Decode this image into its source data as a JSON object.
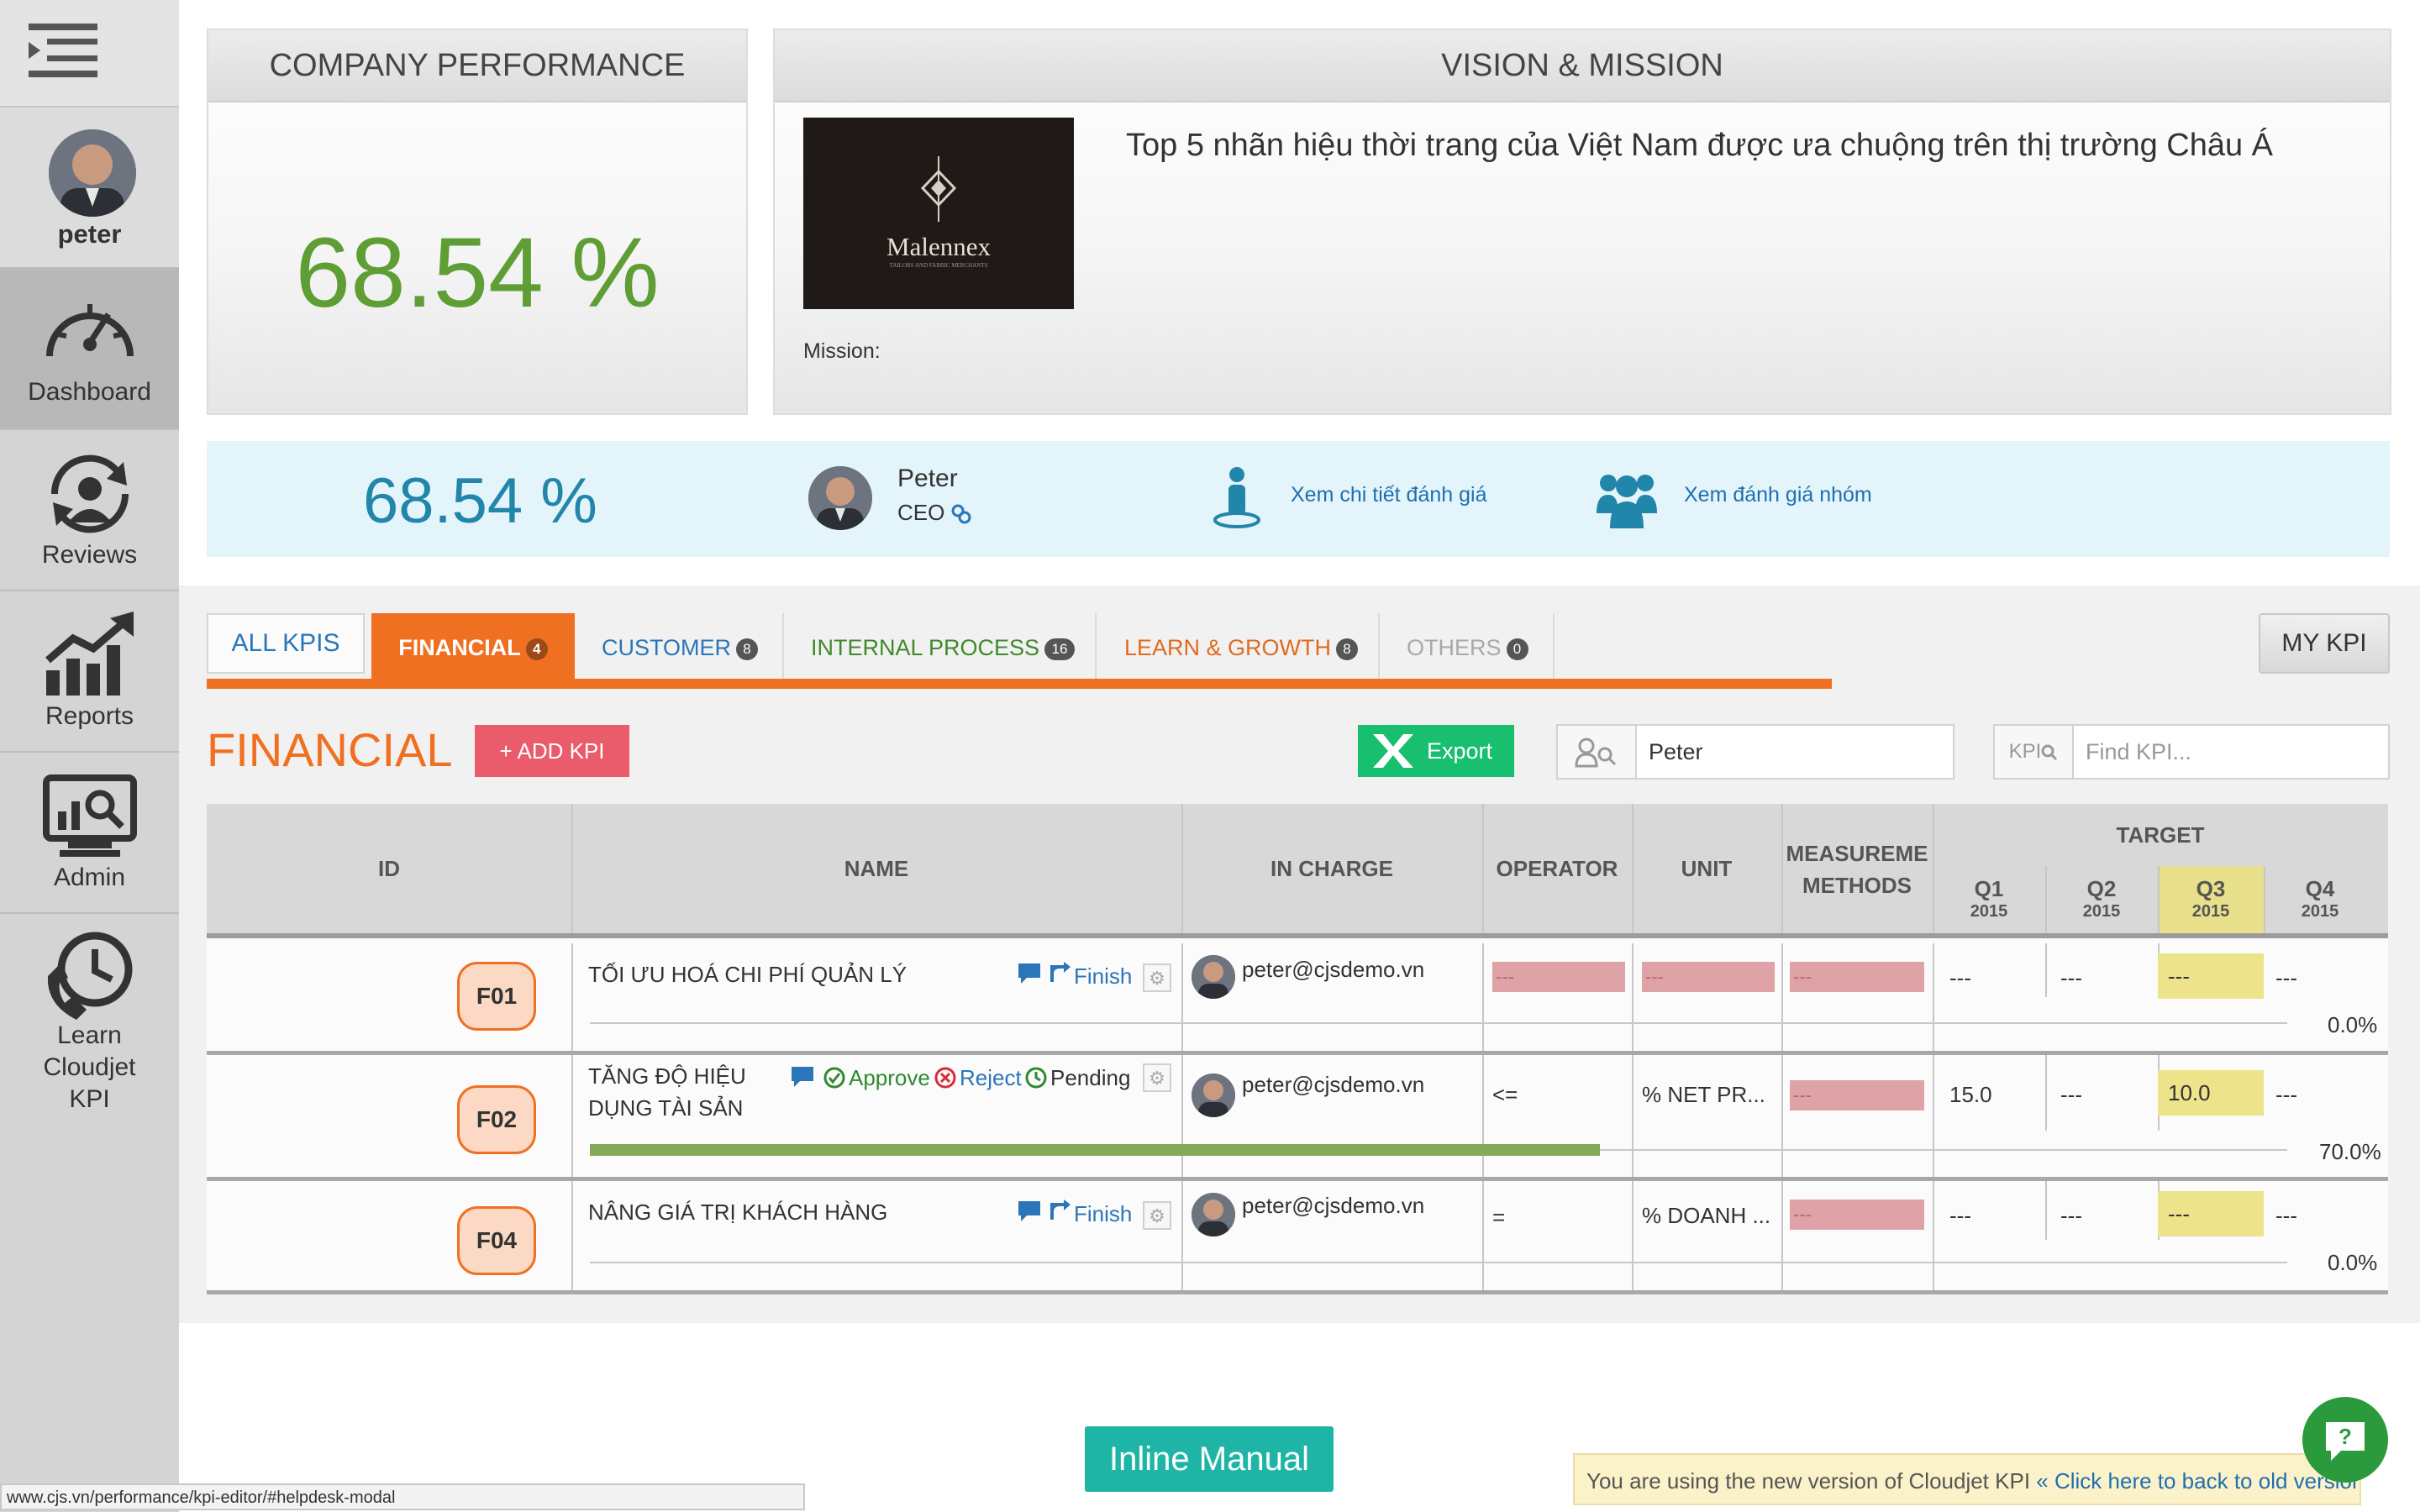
{
  "sidebar": {
    "user": "peter",
    "items": [
      {
        "label": "Dashboard",
        "icon": "speedometer-icon"
      },
      {
        "label": "Reviews",
        "icon": "reviews-icon"
      },
      {
        "label": "Reports",
        "icon": "chart-icon"
      },
      {
        "label": "Admin",
        "icon": "admin-icon"
      },
      {
        "label": "Learn\nCloudjet\nKPI",
        "icon": "clock-phone-icon"
      }
    ]
  },
  "company": {
    "title": "COMPANY PERFORMANCE",
    "percent": "68.54 %"
  },
  "vision": {
    "title": "VISION & MISSION",
    "logo_text": "Malennex",
    "logo_subtext": "TAILORS AND FABRIC MERCHANTS",
    "statement": "Top 5 nhãn hiệu thời trang của Việt Nam được ưa chuộng trên thị trường Châu Á",
    "mission_label": "Mission:"
  },
  "info": {
    "percent": "68.54 %",
    "name": "Peter",
    "role": "CEO",
    "link_detail": "Xem chi tiết đánh giá",
    "link_group": "Xem đánh giá nhóm"
  },
  "tabs": {
    "all": "ALL KPIS",
    "financial": {
      "label": "FINANCIAL",
      "count": "4"
    },
    "customer": {
      "label": "CUSTOMER",
      "count": "8"
    },
    "internal": {
      "label": "INTERNAL PROCESS",
      "count": "16"
    },
    "learn": {
      "label": "LEARN & GROWTH",
      "count": "8"
    },
    "others": {
      "label": "OTHERS",
      "count": "0"
    },
    "my_kpi": "MY KPI"
  },
  "toolbar": {
    "section_title": "FINANCIAL",
    "add_kpi": "+ ADD KPI",
    "export": "Export",
    "person_search_value": "Peter",
    "kpi_prefix": "KPI",
    "kpi_search_placeholder": "Find KPI..."
  },
  "table": {
    "headers": {
      "id": "ID",
      "name": "NAME",
      "in_charge": "IN CHARGE",
      "operator": "OPERATOR",
      "unit": "UNIT",
      "measure": "MEASUREME\nMETHODS",
      "target": "TARGET"
    },
    "quarters": [
      {
        "q": "Q1",
        "year": "2015"
      },
      {
        "q": "Q2",
        "year": "2015"
      },
      {
        "q": "Q3",
        "year": "2015"
      },
      {
        "q": "Q4",
        "year": "2015"
      }
    ],
    "rows": [
      {
        "id": "F01",
        "name": "TỐI ƯU HOÁ CHI PHÍ QUẢN LÝ",
        "status": "Finish",
        "in_charge": "peter@cjsdemo.vn",
        "operator": "---",
        "unit": "---",
        "measure": "---",
        "q1": "---",
        "q2": "---",
        "q3": "---",
        "q4": "---",
        "progress_text": "0.0%",
        "progress": 0
      },
      {
        "id": "F02",
        "name_line1": "TĂNG ĐỘ HIỆU",
        "name_line2": "DỤNG TÀI SẢN",
        "approve": "Approve",
        "reject": "Reject",
        "pending": "Pending",
        "in_charge": "peter@cjsdemo.vn",
        "operator": "<=",
        "unit": "% NET PR...",
        "measure": "---",
        "q1": "15.0",
        "q2": "---",
        "q3": "10.0",
        "q4": "---",
        "progress_text": "70.0%",
        "progress": 0.7
      },
      {
        "id": "F04",
        "name": "NÂNG GIÁ TRỊ KHÁCH HÀNG",
        "status": "Finish",
        "in_charge": "peter@cjsdemo.vn",
        "operator": "=",
        "unit": "% DOANH ...",
        "measure": "---",
        "q1": "---",
        "q2": "---",
        "q3": "---",
        "q4": "---",
        "progress_text": "0.0%",
        "progress": 0
      }
    ]
  },
  "bottom": {
    "inline_manual": "Inline Manual",
    "notice_text": "You are using the new version of Cloudjet KPI",
    "notice_link": "« Click here to back to old version",
    "status_url": "www.cjs.vn/performance/kpi-editor/#helpdesk-modal"
  },
  "colors": {
    "accent_orange": "#f07022",
    "green_pct": "#5e9e35",
    "blue_pct": "#2186a9",
    "export_green": "#18bf6e",
    "add_kpi_red": "#ea5c6c",
    "q3_highlight": "#e8e08a"
  }
}
